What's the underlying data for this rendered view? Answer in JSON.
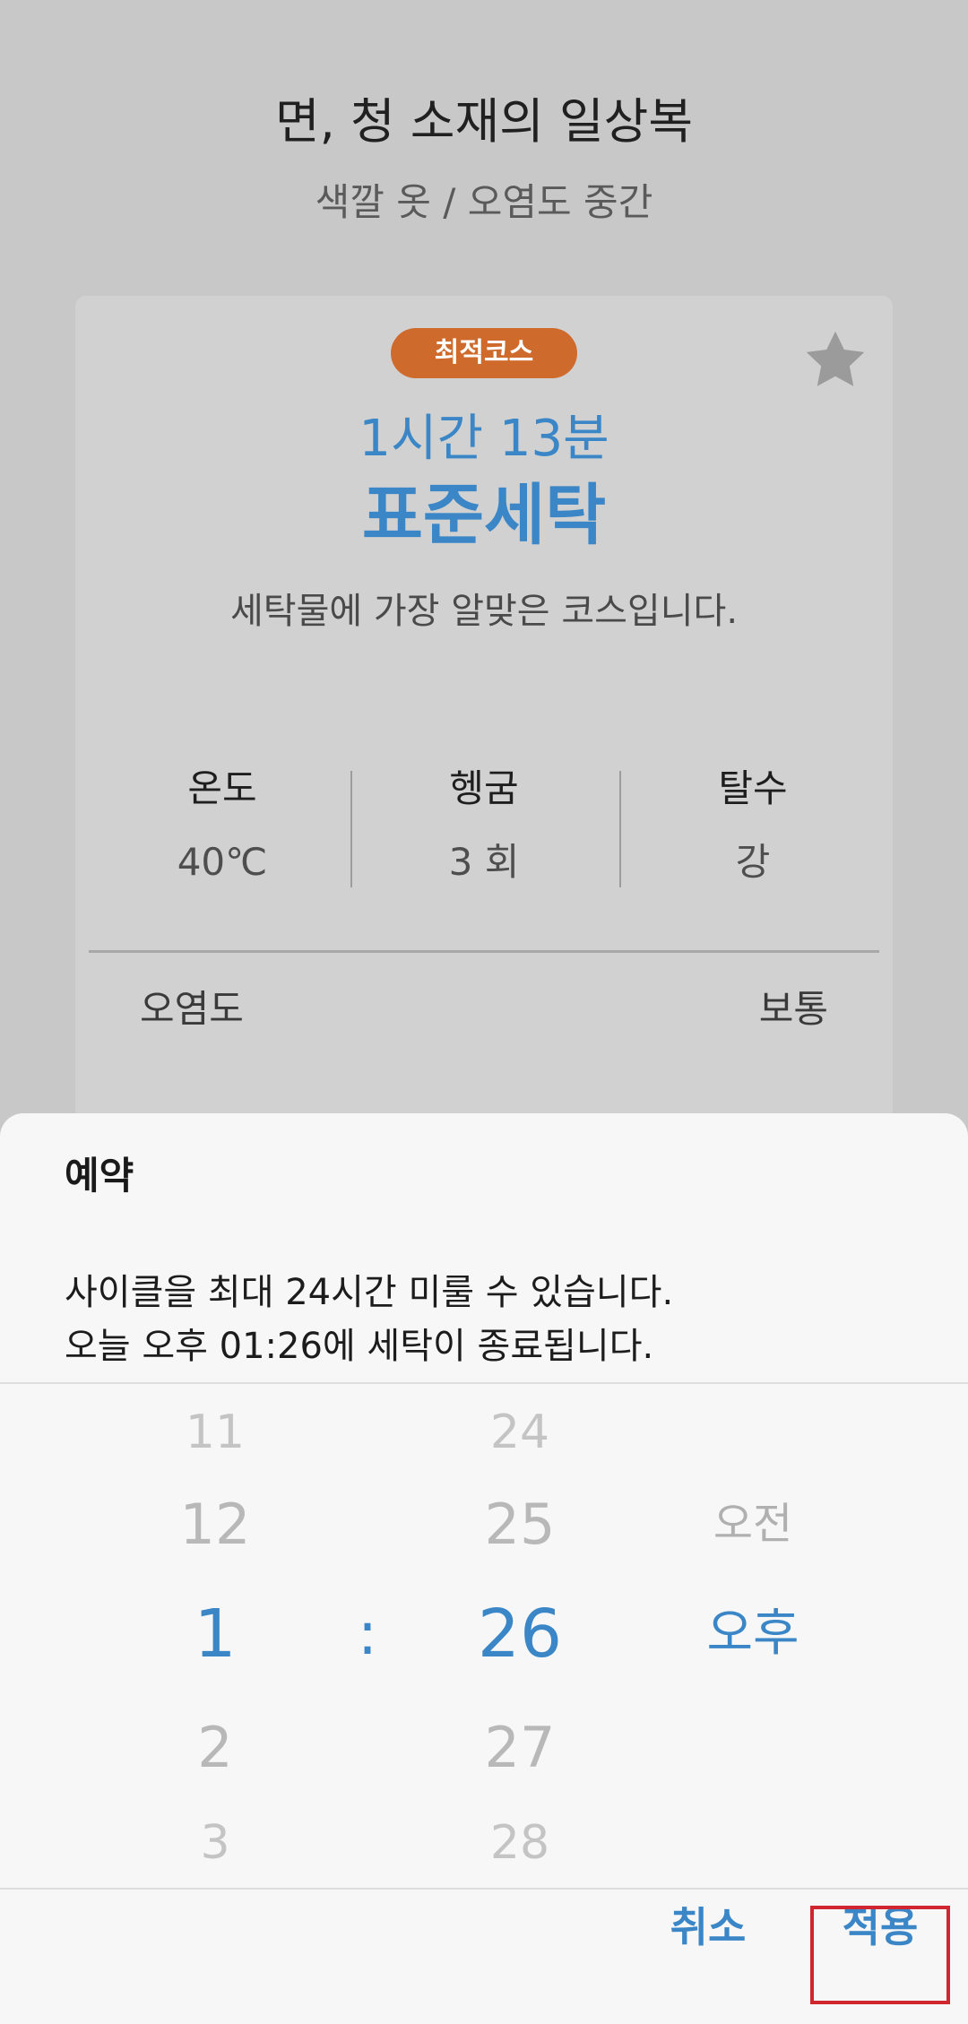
{
  "background": {
    "title": "면, 청 소재의 일상복",
    "subtitle": "색깔 옷 / 오염도 중간",
    "card": {
      "badge": "최적코스",
      "duration": "1시간 13분",
      "course_name": "표준세탁",
      "description": "세탁물에 가장 알맞은 코스입니다.",
      "options": [
        {
          "label": "온도",
          "value": "40℃"
        },
        {
          "label": "헹굼",
          "value": "3 회"
        },
        {
          "label": "탈수",
          "value": "강"
        }
      ],
      "soil_label": "오염도",
      "soil_value": "보통"
    }
  },
  "dialog": {
    "title": "예약",
    "line1": "사이클을 최대 24시간 미룰 수 있습니다.",
    "line2": "오늘 오후 01:26에 세탁이 종료됩니다.",
    "picker": {
      "hours": [
        "11",
        "12",
        "1",
        "2",
        "3"
      ],
      "separator": ":",
      "minutes": [
        "24",
        "25",
        "26",
        "27",
        "28"
      ],
      "ampm": [
        "오전",
        "오후"
      ]
    },
    "cancel_label": "취소",
    "apply_label": "적용"
  },
  "colors": {
    "accent": "#3a86c6",
    "badge": "#cf6a2d",
    "highlight": "#d0262f"
  }
}
